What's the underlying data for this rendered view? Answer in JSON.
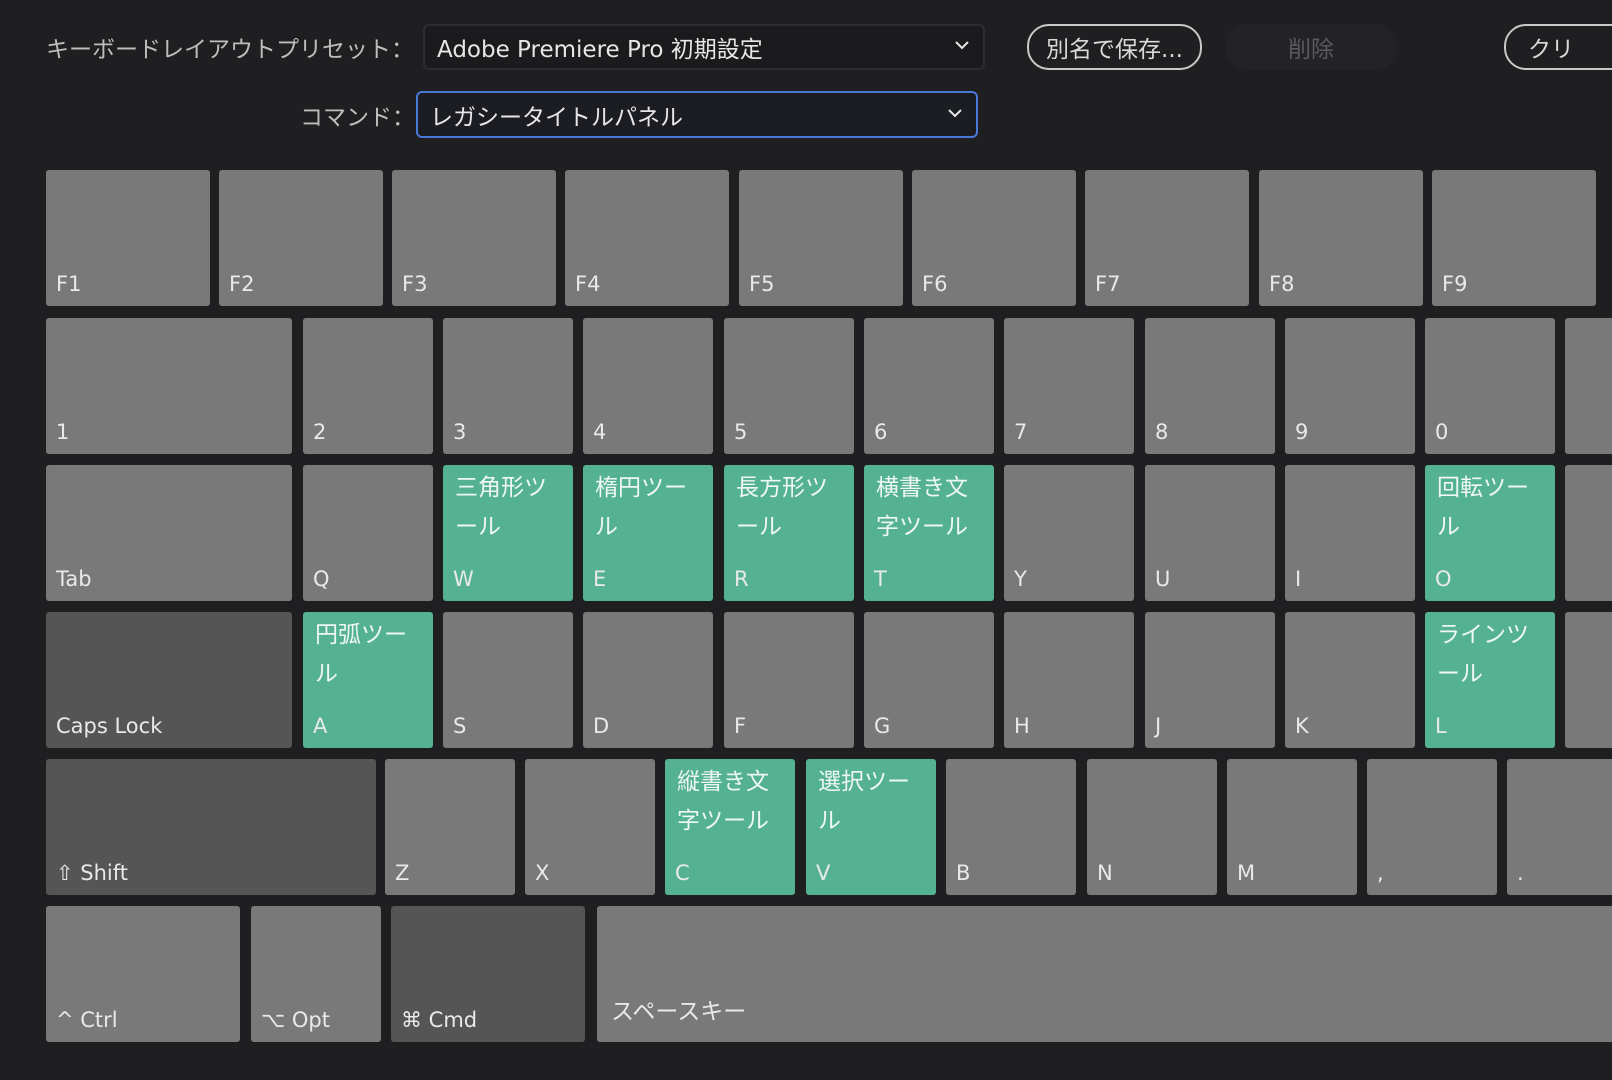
{
  "toolbar": {
    "preset_label": "キーボードレイアウトプリセット：",
    "preset_value": "Adobe Premiere Pro 初期設定",
    "save_as_label": "別名で保存...",
    "delete_label": "削除",
    "clear_label": "クリ",
    "command_label": "コマンド：",
    "command_value": "レガシータイトルパネル"
  },
  "keyboard": {
    "function_row": [
      "F1",
      "F2",
      "F3",
      "F4",
      "F5",
      "F6",
      "F7",
      "F8",
      "F9"
    ],
    "number_row": [
      "1",
      "2",
      "3",
      "4",
      "5",
      "6",
      "7",
      "8",
      "9",
      "0"
    ],
    "tab": "Tab",
    "qwerty_row": [
      {
        "key": "Q",
        "command": ""
      },
      {
        "key": "W",
        "command": "三角形ツール"
      },
      {
        "key": "E",
        "command": "楕円ツール"
      },
      {
        "key": "R",
        "command": "長方形ツール"
      },
      {
        "key": "T",
        "command": "横書き文字ツール"
      },
      {
        "key": "Y",
        "command": ""
      },
      {
        "key": "U",
        "command": ""
      },
      {
        "key": "I",
        "command": ""
      },
      {
        "key": "O",
        "command": "回転ツール"
      }
    ],
    "caps_lock": "Caps Lock",
    "home_row": [
      {
        "key": "A",
        "command": "円弧ツール"
      },
      {
        "key": "S",
        "command": ""
      },
      {
        "key": "D",
        "command": ""
      },
      {
        "key": "F",
        "command": ""
      },
      {
        "key": "G",
        "command": ""
      },
      {
        "key": "H",
        "command": ""
      },
      {
        "key": "J",
        "command": ""
      },
      {
        "key": "K",
        "command": ""
      },
      {
        "key": "L",
        "command": "ラインツール"
      }
    ],
    "shift": "⇧ Shift",
    "bottom_row": [
      {
        "key": "Z",
        "command": ""
      },
      {
        "key": "X",
        "command": ""
      },
      {
        "key": "C",
        "command": "縦書き文字ツール"
      },
      {
        "key": "V",
        "command": "選択ツール"
      },
      {
        "key": "B",
        "command": ""
      },
      {
        "key": "N",
        "command": ""
      },
      {
        "key": "M",
        "command": ""
      },
      {
        "key": ",",
        "command": ""
      },
      {
        "key": ".",
        "command": ""
      }
    ],
    "ctrl": "^ Ctrl",
    "opt": "⌥ Opt",
    "cmd": "⌘ Cmd",
    "space": "スペースキー"
  },
  "colors": {
    "background": "#1f1f21",
    "key_default": "#797979",
    "key_modifier": "#555555",
    "key_assigned": "#54b292",
    "focus_border": "#4a78d6"
  }
}
